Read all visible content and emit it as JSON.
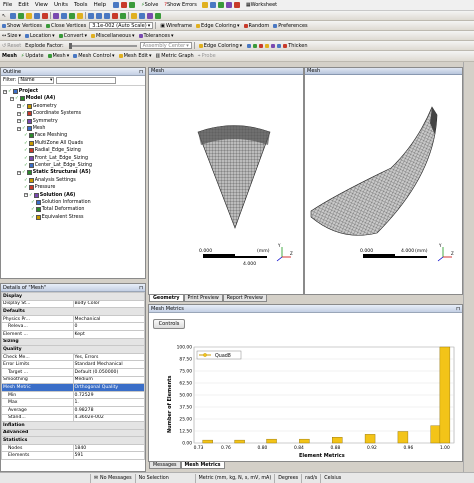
{
  "menu": {
    "items": [
      "File",
      "Edit",
      "View",
      "Units",
      "Tools",
      "Help"
    ]
  },
  "toolbar1": {
    "solve": "Solve",
    "show_errors": "Show Errors",
    "worksheet": "Worksheet"
  },
  "toolbar2": {
    "show_vertices": "Show Vertices",
    "close_vertices": "Close Vertices",
    "scale_value": "3.1e-002 (Auto Scale)",
    "wireframe": "Wireframe",
    "edge_coloring": "Edge Coloring",
    "random": "Random",
    "preferences": "Preferences"
  },
  "toolbar3": {
    "size": "Size",
    "location": "Location",
    "convert": "Convert",
    "miscellaneous": "Miscellaneous",
    "tolerances": "Tolerances"
  },
  "toolbar4": {
    "reset": "Reset",
    "explode_factor": "Explode Factor:",
    "assembly_center": "Assembly Center",
    "edge_coloring": "Edge Coloring",
    "thicken": "Thicken"
  },
  "toolbar5": {
    "mesh": "Mesh",
    "update": "Update",
    "mesh2": "Mesh",
    "mesh_control": "Mesh Control",
    "mesh_edit": "Mesh Edit",
    "metric_graph": "Metric Graph",
    "probe": "Probe"
  },
  "outline": {
    "title": "Outline",
    "filter_label": "Filter:",
    "filter_value": "Name",
    "nodes": [
      {
        "label": "Project",
        "level": 0,
        "bold": true,
        "icon": "project-icon"
      },
      {
        "label": "Model (A4)",
        "level": 1,
        "bold": true,
        "icon": "model-icon"
      },
      {
        "label": "Geometry",
        "level": 2,
        "icon": "geometry-icon"
      },
      {
        "label": "Coordinate Systems",
        "level": 2,
        "icon": "coordinate-icon"
      },
      {
        "label": "Symmetry",
        "level": 2,
        "icon": "symmetry-icon"
      },
      {
        "label": "Mesh",
        "level": 2,
        "icon": "mesh-icon"
      },
      {
        "label": "Face Meshing",
        "level": 3,
        "icon": "face-meshing-icon"
      },
      {
        "label": "MultiZone All Quads",
        "level": 3,
        "icon": "multizone-icon"
      },
      {
        "label": "Radial_Edge_Sizing",
        "level": 3,
        "icon": "sizing-icon"
      },
      {
        "label": "Front_Lat_Edge_Sizing",
        "level": 3,
        "icon": "sizing-icon"
      },
      {
        "label": "Center_Lat_Edge_Sizing",
        "level": 3,
        "icon": "sizing-icon"
      },
      {
        "label": "Static Structural (A5)",
        "level": 2,
        "bold": true,
        "icon": "static-structural-icon"
      },
      {
        "label": "Analysis Settings",
        "level": 3,
        "icon": "analysis-settings-icon"
      },
      {
        "label": "Pressure",
        "level": 3,
        "icon": "pressure-icon"
      },
      {
        "label": "Solution (A6)",
        "level": 3,
        "bold": true,
        "icon": "solution-icon"
      },
      {
        "label": "Solution Information",
        "level": 4,
        "icon": "solution-info-icon"
      },
      {
        "label": "Total Deformation",
        "level": 4,
        "icon": "deformation-icon"
      },
      {
        "label": "Equivalent Stress",
        "level": 4,
        "icon": "stress-icon"
      }
    ]
  },
  "details": {
    "title": "Details of \"Mesh\"",
    "rows": [
      {
        "type": "grp",
        "k": "Display",
        "v": ""
      },
      {
        "type": "row",
        "k": "Display St...",
        "v": "Body Color"
      },
      {
        "type": "grp",
        "k": "Defaults",
        "v": ""
      },
      {
        "type": "row",
        "k": "Physics Pr...",
        "v": "Mechanical"
      },
      {
        "type": "ind",
        "k": "Releva...",
        "v": "0"
      },
      {
        "type": "row",
        "k": "Element ...",
        "v": "Kept"
      },
      {
        "type": "grp",
        "k": "Sizing",
        "v": ""
      },
      {
        "type": "grp",
        "k": "Quality",
        "v": ""
      },
      {
        "type": "row",
        "k": "Check Me...",
        "v": "Yes, Errors"
      },
      {
        "type": "row",
        "k": "Error Limits",
        "v": "Standard Mechanical"
      },
      {
        "type": "ind",
        "k": "Target ...",
        "v": "Default (0.050000)"
      },
      {
        "type": "row",
        "k": "Smoothing",
        "v": "Medium"
      },
      {
        "type": "sel",
        "k": "Mesh Metric",
        "v": "Orthogonal Quality"
      },
      {
        "type": "ind",
        "k": "Min",
        "v": "0.72529"
      },
      {
        "type": "ind",
        "k": "Max",
        "v": "1."
      },
      {
        "type": "ind",
        "k": "Average",
        "v": "0.98278"
      },
      {
        "type": "ind",
        "k": "Stand...",
        "v": "4.3602e-002"
      },
      {
        "type": "grp",
        "k": "Inflation",
        "v": ""
      },
      {
        "type": "grp",
        "k": "Advanced",
        "v": ""
      },
      {
        "type": "grp",
        "k": "Statistics",
        "v": ""
      },
      {
        "type": "ind",
        "k": "Nodes",
        "v": "1840"
      },
      {
        "type": "ind",
        "k": "Elements",
        "v": "591"
      }
    ]
  },
  "viewport_left": {
    "title": "Mesh",
    "scale_start": "0.000",
    "scale_end": "4.000",
    "scale_unit": "(mm)",
    "scale_mid": "2.000"
  },
  "viewport_right": {
    "title": "Mesh",
    "scale_start": "0.000",
    "scale_end": "4.000",
    "scale_unit": "(mm)",
    "scale_mid": "2.000"
  },
  "view_tabs": [
    "Geometry",
    "Print Preview",
    "Report Preview"
  ],
  "metrics_panel": {
    "title": "Mesh Metrics",
    "controls_label": "Controls"
  },
  "bottom_tabs": [
    "Messages",
    "Mesh Metrics"
  ],
  "status_bar": {
    "messages": "No Messages",
    "selection": "No Selection",
    "units": "Metric (mm, kg, N, s, mV, mA)",
    "angle": "Degrees",
    "rad": "rad/s",
    "temp": "Celsius"
  },
  "colors": {
    "bar_fill": "#f3c418",
    "bar_stroke": "#8a6a00",
    "accent": "#3a6ec8"
  },
  "chart_data": {
    "type": "bar",
    "xlabel": "Element Metrics",
    "ylabel": "Number of Elements",
    "legend": [
      "Quad8"
    ],
    "legend_position": "top-left",
    "grid": true,
    "x_ticks": [
      "0.73",
      "0.76",
      "0.80",
      "0.84",
      "0.88",
      "0.92",
      "0.96",
      "1.00"
    ],
    "y_ticks": [
      "0.00",
      "12.50",
      "25.00",
      "37.50",
      "50.00",
      "62.50",
      "75.00",
      "87.50",
      "100.00"
    ],
    "xlim": [
      0.725,
      1.01
    ],
    "ylim": [
      0,
      100
    ],
    "bars": [
      {
        "x": 0.74,
        "y": 3
      },
      {
        "x": 0.775,
        "y": 3
      },
      {
        "x": 0.81,
        "y": 4
      },
      {
        "x": 0.846,
        "y": 4
      },
      {
        "x": 0.882,
        "y": 6
      },
      {
        "x": 0.918,
        "y": 9
      },
      {
        "x": 0.954,
        "y": 12
      },
      {
        "x": 0.99,
        "y": 18
      },
      {
        "x": 1.0,
        "y": 100
      }
    ]
  }
}
